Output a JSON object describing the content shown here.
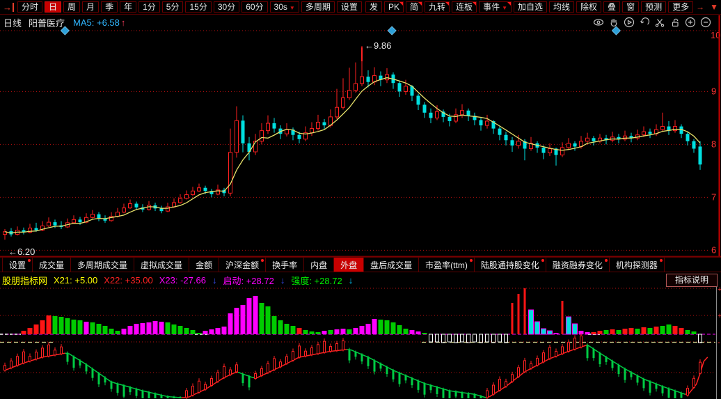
{
  "colors": {
    "accent_red": "#c80000",
    "up": "#ff2020",
    "down": "#00e0e0",
    "ma_line": "#e6e06a",
    "grid_dot": "#bb1111",
    "axis_label": "#ff3333",
    "magenta": "#ff00ff",
    "hist_green": "#00cc00",
    "marker_blue": "#2da0d8",
    "osc_up": "#ff2222",
    "osc_down": "#00cc44"
  },
  "toolbar": {
    "lead_icon": "import-arrow-icon",
    "periods": [
      {
        "label": "分时"
      },
      {
        "label": "日",
        "selected": true
      },
      {
        "label": "周"
      },
      {
        "label": "月"
      },
      {
        "label": "季"
      },
      {
        "label": "年"
      },
      {
        "label": "1分"
      },
      {
        "label": "5分"
      },
      {
        "label": "15分"
      },
      {
        "label": "30分"
      },
      {
        "label": "60分"
      },
      {
        "label": "30s",
        "dropdown": true
      },
      {
        "label": "多周期"
      },
      {
        "label": "设置"
      }
    ],
    "right_buttons": [
      {
        "label": "发"
      },
      {
        "label": "PK",
        "badge": true
      },
      {
        "label": "简",
        "badge": true
      },
      {
        "label": "九转",
        "badge": true
      },
      {
        "label": "连板",
        "badge": true
      },
      {
        "label": "事件",
        "badge": true,
        "dropdown": true
      },
      {
        "label": "加自选"
      },
      {
        "label": "均线"
      },
      {
        "label": "除权"
      },
      {
        "label": "叠"
      },
      {
        "label": "窗"
      },
      {
        "label": "预测"
      },
      {
        "label": "更多"
      }
    ],
    "right_glyphs": [
      "→",
      "▼"
    ]
  },
  "chart_header": {
    "period_label": "日线",
    "stock_name": "阳普医疗",
    "ma_label": "MA5: +6.58",
    "ma_arrow": "↑",
    "icons": [
      "eye-icon",
      "hand-icon",
      "play-icon",
      "undo-icon",
      "scissors-icon",
      "lock-icon",
      "zoom-in-icon",
      "zoom-out-icon"
    ]
  },
  "tabs": [
    {
      "label": "设置",
      "dot": true
    },
    {
      "label": "成交量"
    },
    {
      "label": "多周期成交量"
    },
    {
      "label": "虚拟成交量"
    },
    {
      "label": "金额"
    },
    {
      "label": "沪深金额",
      "dot": true
    },
    {
      "label": "换手率"
    },
    {
      "label": "内盘"
    },
    {
      "label": "外盘",
      "selected": true
    },
    {
      "label": "盘后成交量"
    },
    {
      "label": "市盈率(ttm)",
      "dot": true
    },
    {
      "label": "陆股通持股变化",
      "dot": true
    },
    {
      "label": "融资融券变化",
      "dot": true
    },
    {
      "label": "机构探测器",
      "dot": true
    }
  ],
  "indicator_header": {
    "tokens": [
      {
        "text": "股朋指标网",
        "color": "#ffff00"
      },
      {
        "text": "X21: +5.00",
        "color": "#ffff00"
      },
      {
        "text": "X22: +35.00",
        "color": "#ff2222"
      },
      {
        "text": "X23: -27.66",
        "color": "#ff00ff"
      },
      {
        "text": "↓",
        "color": "#3a50ff"
      },
      {
        "text": "启动: +28.72",
        "color": "#ff00ff"
      },
      {
        "text": "↓",
        "color": "#3a50ff"
      },
      {
        "text": "强度: +28.72",
        "color": "#00ee00"
      },
      {
        "text": "↓",
        "color": "#00ccff"
      }
    ],
    "help_button": "指标说明",
    "axis_marks": [
      "+",
      "+",
      "-"
    ]
  },
  "chart_data": {
    "type": "candlestick+indicator",
    "price_axis": {
      "ticks": [
        10,
        9,
        8,
        7,
        6
      ],
      "visible_range": [
        6.0,
        10.0
      ],
      "grid": "dotted"
    },
    "annotations": {
      "high": {
        "index": 57,
        "price": 9.86,
        "label": "9.86"
      },
      "low": {
        "index": 0,
        "price": 6.2,
        "label": "6.20"
      }
    },
    "event_marker_indices": [
      9.6,
      61.8,
      97.6
    ],
    "ma_period": 5,
    "candles": [
      [
        6.3,
        6.35,
        6.4,
        6.2
      ],
      [
        6.36,
        6.3,
        6.42,
        6.26
      ],
      [
        6.3,
        6.38,
        6.45,
        6.28
      ],
      [
        6.38,
        6.34,
        6.43,
        6.3
      ],
      [
        6.34,
        6.42,
        6.5,
        6.32
      ],
      [
        6.42,
        6.38,
        6.52,
        6.35
      ],
      [
        6.38,
        6.46,
        6.55,
        6.36
      ],
      [
        6.46,
        6.53,
        6.62,
        6.44
      ],
      [
        6.53,
        6.47,
        6.58,
        6.42
      ],
      [
        6.47,
        6.44,
        6.55,
        6.4
      ],
      [
        6.44,
        6.52,
        6.6,
        6.42
      ],
      [
        6.52,
        6.58,
        6.66,
        6.5
      ],
      [
        6.58,
        6.53,
        6.63,
        6.48
      ],
      [
        6.53,
        6.62,
        6.7,
        6.51
      ],
      [
        6.62,
        6.68,
        6.76,
        6.6
      ],
      [
        6.68,
        6.6,
        6.72,
        6.55
      ],
      [
        6.6,
        6.56,
        6.66,
        6.52
      ],
      [
        6.56,
        6.64,
        6.72,
        6.54
      ],
      [
        6.64,
        6.72,
        6.8,
        6.62
      ],
      [
        6.72,
        6.8,
        6.88,
        6.7
      ],
      [
        6.8,
        6.88,
        6.96,
        6.78
      ],
      [
        6.88,
        6.81,
        6.92,
        6.76
      ],
      [
        6.81,
        6.77,
        6.87,
        6.72
      ],
      [
        6.77,
        6.85,
        6.93,
        6.75
      ],
      [
        6.85,
        6.79,
        6.9,
        6.74
      ],
      [
        6.79,
        6.74,
        6.84,
        6.7
      ],
      [
        6.74,
        6.82,
        6.9,
        6.72
      ],
      [
        6.82,
        6.9,
        6.98,
        6.8
      ],
      [
        6.9,
        6.98,
        7.06,
        6.88
      ],
      [
        6.98,
        7.05,
        7.13,
        6.96
      ],
      [
        7.05,
        7.12,
        7.2,
        7.03
      ],
      [
        7.12,
        7.18,
        7.26,
        7.1
      ],
      [
        7.18,
        7.12,
        7.22,
        7.06
      ],
      [
        7.12,
        7.06,
        7.16,
        7.0
      ],
      [
        7.06,
        7.14,
        7.24,
        7.04
      ],
      [
        7.14,
        7.08,
        7.18,
        7.02
      ],
      [
        7.08,
        7.85,
        8.3,
        7.02
      ],
      [
        7.85,
        8.45,
        8.72,
        7.75
      ],
      [
        8.45,
        8.02,
        8.55,
        7.85
      ],
      [
        8.02,
        7.86,
        8.14,
        7.7
      ],
      [
        7.86,
        8.06,
        8.2,
        7.8
      ],
      [
        8.06,
        8.26,
        8.4,
        8.0
      ],
      [
        8.26,
        8.4,
        8.55,
        8.2
      ],
      [
        8.4,
        8.3,
        8.5,
        8.22
      ],
      [
        8.3,
        8.2,
        8.36,
        8.1
      ],
      [
        8.2,
        8.28,
        8.4,
        8.15
      ],
      [
        8.28,
        8.18,
        8.32,
        8.08
      ],
      [
        8.18,
        8.1,
        8.24,
        8.02
      ],
      [
        8.1,
        8.22,
        8.34,
        8.06
      ],
      [
        8.22,
        8.3,
        8.42,
        8.16
      ],
      [
        8.3,
        8.42,
        8.56,
        8.26
      ],
      [
        8.42,
        8.36,
        8.48,
        8.28
      ],
      [
        8.36,
        8.52,
        8.66,
        8.32
      ],
      [
        8.52,
        8.7,
        9.05,
        8.48
      ],
      [
        8.7,
        8.88,
        9.25,
        8.66
      ],
      [
        8.88,
        9.02,
        9.45,
        8.84
      ],
      [
        9.02,
        9.15,
        9.55,
        8.98
      ],
      [
        9.15,
        9.28,
        9.86,
        9.1
      ],
      [
        9.28,
        9.18,
        9.4,
        9.08
      ],
      [
        9.18,
        9.3,
        9.46,
        9.12
      ],
      [
        9.3,
        9.22,
        9.38,
        9.1
      ],
      [
        9.22,
        9.32,
        9.44,
        9.16
      ],
      [
        9.32,
        9.16,
        9.36,
        9.05
      ],
      [
        9.16,
        9.0,
        9.2,
        8.9
      ],
      [
        9.0,
        9.1,
        9.22,
        8.94
      ],
      [
        9.1,
        8.92,
        9.12,
        8.82
      ],
      [
        8.92,
        8.75,
        8.96,
        8.65
      ],
      [
        8.75,
        8.6,
        8.8,
        8.5
      ],
      [
        8.6,
        8.5,
        8.68,
        8.4
      ],
      [
        8.5,
        8.62,
        8.74,
        8.46
      ],
      [
        8.62,
        8.52,
        8.66,
        8.42
      ],
      [
        8.52,
        8.44,
        8.58,
        8.34
      ],
      [
        8.44,
        8.56,
        8.68,
        8.4
      ],
      [
        8.56,
        8.64,
        8.76,
        8.5
      ],
      [
        8.64,
        8.54,
        8.68,
        8.44
      ],
      [
        8.54,
        8.46,
        8.6,
        8.36
      ],
      [
        8.46,
        8.36,
        8.5,
        8.26
      ],
      [
        8.36,
        8.44,
        8.56,
        8.3
      ],
      [
        8.44,
        8.3,
        8.46,
        8.2
      ],
      [
        8.3,
        8.18,
        8.34,
        8.08
      ],
      [
        8.18,
        8.08,
        8.24,
        7.98
      ],
      [
        8.08,
        7.98,
        8.14,
        7.86
      ],
      [
        7.98,
        8.06,
        8.18,
        7.92
      ],
      [
        8.06,
        7.92,
        8.1,
        7.7
      ],
      [
        7.92,
        8.02,
        8.14,
        7.88
      ],
      [
        8.02,
        7.94,
        8.06,
        7.84
      ],
      [
        7.94,
        7.84,
        7.98,
        7.72
      ],
      [
        7.84,
        7.92,
        8.02,
        7.78
      ],
      [
        7.92,
        7.8,
        7.94,
        7.6
      ],
      [
        7.8,
        7.94,
        8.04,
        7.76
      ],
      [
        7.94,
        8.02,
        8.12,
        7.9
      ],
      [
        8.02,
        7.96,
        8.06,
        7.88
      ],
      [
        7.96,
        8.06,
        8.16,
        7.92
      ],
      [
        8.06,
        8.12,
        8.22,
        8.0
      ],
      [
        8.12,
        8.06,
        8.16,
        7.98
      ],
      [
        8.06,
        8.12,
        8.2,
        8.02
      ],
      [
        8.12,
        8.08,
        8.18,
        8.0
      ],
      [
        8.08,
        8.14,
        8.24,
        8.04
      ],
      [
        8.14,
        8.1,
        8.2,
        8.02
      ],
      [
        8.1,
        8.16,
        8.26,
        8.06
      ],
      [
        8.16,
        8.12,
        8.22,
        8.04
      ],
      [
        8.12,
        8.18,
        8.28,
        8.08
      ],
      [
        8.18,
        8.24,
        8.34,
        8.14
      ],
      [
        8.24,
        8.2,
        8.3,
        8.12
      ],
      [
        8.2,
        8.28,
        8.38,
        8.16
      ],
      [
        8.28,
        8.34,
        8.6,
        8.24
      ],
      [
        8.34,
        8.26,
        8.44,
        8.18
      ],
      [
        8.26,
        8.34,
        8.46,
        8.22
      ],
      [
        8.34,
        8.2,
        8.38,
        8.12
      ],
      [
        8.2,
        8.06,
        8.24,
        7.98
      ],
      [
        8.06,
        7.92,
        8.1,
        7.84
      ],
      [
        7.96,
        7.62,
        8.06,
        7.52
      ]
    ],
    "histogram": [
      [
        0,
        "g"
      ],
      [
        0,
        "g"
      ],
      [
        0,
        "g"
      ],
      [
        5,
        "r"
      ],
      [
        9,
        "r"
      ],
      [
        14,
        "r"
      ],
      [
        20,
        "r"
      ],
      [
        27,
        "r"
      ],
      [
        26,
        "g"
      ],
      [
        25,
        "g"
      ],
      [
        23,
        "g"
      ],
      [
        21,
        "g"
      ],
      [
        20,
        "g"
      ],
      [
        18,
        "m"
      ],
      [
        17,
        "g"
      ],
      [
        15,
        "g"
      ],
      [
        12,
        "g"
      ],
      [
        8,
        "g"
      ],
      [
        5,
        "g"
      ],
      [
        8,
        "m"
      ],
      [
        12,
        "m"
      ],
      [
        15,
        "m"
      ],
      [
        16,
        "m"
      ],
      [
        17,
        "m"
      ],
      [
        19,
        "m"
      ],
      [
        18,
        "m"
      ],
      [
        17,
        "g"
      ],
      [
        14,
        "g"
      ],
      [
        12,
        "g"
      ],
      [
        9,
        "g"
      ],
      [
        6,
        "g"
      ],
      [
        2,
        "g"
      ],
      [
        5,
        "m"
      ],
      [
        7,
        "m"
      ],
      [
        9,
        "m"
      ],
      [
        11,
        "m"
      ],
      [
        30,
        "m"
      ],
      [
        38,
        "m"
      ],
      [
        42,
        "m"
      ],
      [
        52,
        "m"
      ],
      [
        55,
        "m"
      ],
      [
        45,
        "g"
      ],
      [
        40,
        "g"
      ],
      [
        26,
        "g"
      ],
      [
        20,
        "g"
      ],
      [
        15,
        "g"
      ],
      [
        12,
        "g"
      ],
      [
        9,
        "r"
      ],
      [
        6,
        "g"
      ],
      [
        4,
        "g"
      ],
      [
        3,
        "g"
      ],
      [
        5,
        "m"
      ],
      [
        6,
        "g"
      ],
      [
        7,
        "m"
      ],
      [
        8,
        "m"
      ],
      [
        7,
        "g"
      ],
      [
        9,
        "m"
      ],
      [
        12,
        "m"
      ],
      [
        15,
        "m"
      ],
      [
        22,
        "m"
      ],
      [
        21,
        "g"
      ],
      [
        20,
        "g"
      ],
      [
        17,
        "g"
      ],
      [
        13,
        "g"
      ],
      [
        8,
        "g"
      ],
      [
        6,
        "m"
      ],
      [
        4,
        "m"
      ],
      [
        2,
        "g"
      ],
      [
        -11,
        "w"
      ],
      [
        -11,
        "w"
      ],
      [
        -12,
        "w"
      ],
      [
        -11,
        "w"
      ],
      [
        -12,
        "w"
      ],
      [
        -11,
        "w"
      ],
      [
        -12,
        "w"
      ],
      [
        -11,
        "w"
      ],
      [
        -12,
        "w"
      ],
      [
        -11,
        "w"
      ],
      [
        -12,
        "w"
      ],
      [
        -11,
        "w"
      ],
      [
        -12,
        "w"
      ],
      [
        45,
        "s"
      ],
      [
        58,
        "s"
      ],
      [
        66,
        "s"
      ],
      [
        35,
        "c"
      ],
      [
        18,
        "c"
      ],
      [
        8,
        "c"
      ],
      [
        5,
        "c"
      ],
      [
        2,
        "m"
      ],
      [
        48,
        "s"
      ],
      [
        25,
        "c"
      ],
      [
        15,
        "c"
      ],
      [
        5,
        "m"
      ],
      [
        3,
        "m"
      ],
      [
        3,
        "r"
      ],
      [
        5,
        "r"
      ],
      [
        6,
        "g"
      ],
      [
        7,
        "r"
      ],
      [
        6,
        "g"
      ],
      [
        8,
        "r"
      ],
      [
        9,
        "r"
      ],
      [
        8,
        "g"
      ],
      [
        10,
        "r"
      ],
      [
        9,
        "g"
      ],
      [
        11,
        "r"
      ],
      [
        12,
        "g"
      ],
      [
        14,
        "g"
      ],
      [
        12,
        "r"
      ],
      [
        9,
        "r"
      ],
      [
        6,
        "g"
      ],
      [
        4,
        "g"
      ],
      [
        -12,
        "w"
      ]
    ],
    "oscillator_points": [
      [
        0,
        0.1
      ],
      [
        3,
        0.35
      ],
      [
        6,
        0.55
      ],
      [
        10,
        0.7
      ],
      [
        13,
        0.3
      ],
      [
        17,
        -0.3
      ],
      [
        22,
        -0.6
      ],
      [
        26,
        -0.8
      ],
      [
        29,
        -0.85
      ],
      [
        32,
        -0.55
      ],
      [
        35,
        -0.15
      ],
      [
        37,
        0.05
      ],
      [
        40,
        -0.18
      ],
      [
        44,
        0.22
      ],
      [
        47,
        0.55
      ],
      [
        52,
        0.75
      ],
      [
        55,
        0.82
      ],
      [
        58,
        0.55
      ],
      [
        62,
        0.1
      ],
      [
        67,
        -0.35
      ],
      [
        71,
        -0.6
      ],
      [
        75,
        -0.72
      ],
      [
        77,
        -0.85
      ],
      [
        80,
        -0.45
      ],
      [
        83,
        0.05
      ],
      [
        87,
        0.5
      ],
      [
        90,
        0.75
      ],
      [
        93,
        0.97
      ],
      [
        96,
        0.55
      ],
      [
        99,
        0.15
      ],
      [
        102,
        -0.2
      ],
      [
        105,
        -0.45
      ],
      [
        107,
        -0.6
      ],
      [
        109,
        -0.75
      ],
      [
        110.5,
        -0.35
      ],
      [
        111.8,
        0.55
      ]
    ]
  }
}
